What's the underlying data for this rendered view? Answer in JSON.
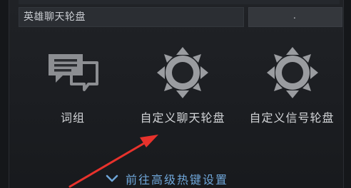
{
  "dropdown": {
    "label": "英雄聊天轮盘"
  },
  "value_box": {
    "text": "."
  },
  "options": [
    {
      "label": "词组",
      "icon": "chat-bubbles-icon"
    },
    {
      "label": "自定义聊天轮盘",
      "icon": "wheel-icon"
    },
    {
      "label": "自定义信号轮盘",
      "icon": "wheel-icon"
    }
  ],
  "advanced": {
    "label": "前往高级热键设置",
    "icon": "chevron-down-icon"
  },
  "colors": {
    "background": "#1d1f23",
    "icon": "#9a9ca0",
    "link": "#6fa6d9",
    "annotation_arrow": "#e8322c"
  }
}
